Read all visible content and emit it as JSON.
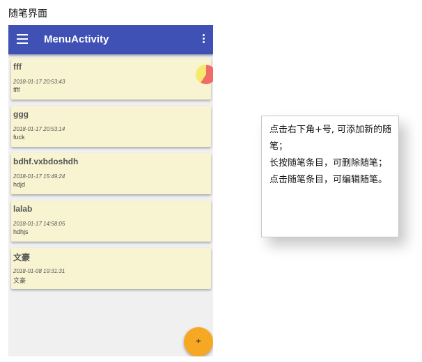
{
  "page": {
    "title": "随笔界面"
  },
  "app_bar": {
    "title": "MenuActivity"
  },
  "notes": [
    {
      "title": "fff",
      "time": "2018-01-17 20:53:43",
      "content": "ffff"
    },
    {
      "title": "ggg",
      "time": "2018-01-17 20:53:14",
      "content": "fuck"
    },
    {
      "title": "bdhf.vxbdoshdh",
      "time": "2018-01-17 15:49:24",
      "content": "hdjd"
    },
    {
      "title": "lalab",
      "time": "2018-01-17 14:58:05",
      "content": "hdhjs"
    },
    {
      "title": "文豪",
      "time": "2018-01-08 19:31:31",
      "content": "文豪"
    }
  ],
  "fab": {
    "label": "+"
  },
  "instructions": "点击右下角+号, 可添加新的随笔；\n长按随笔条目，可删除随笔；\n点击随笔条目，可编辑随笔。",
  "colors": {
    "app_bar": "#3f51b5",
    "card": "#f8f4d1",
    "fab": "#f7a823",
    "pie_yellow": "#f6e96d",
    "pie_red": "#f26b6b"
  },
  "icons": [
    "menu-icon",
    "overflow-menu-icon",
    "pie-chart-icon",
    "add-icon"
  ]
}
